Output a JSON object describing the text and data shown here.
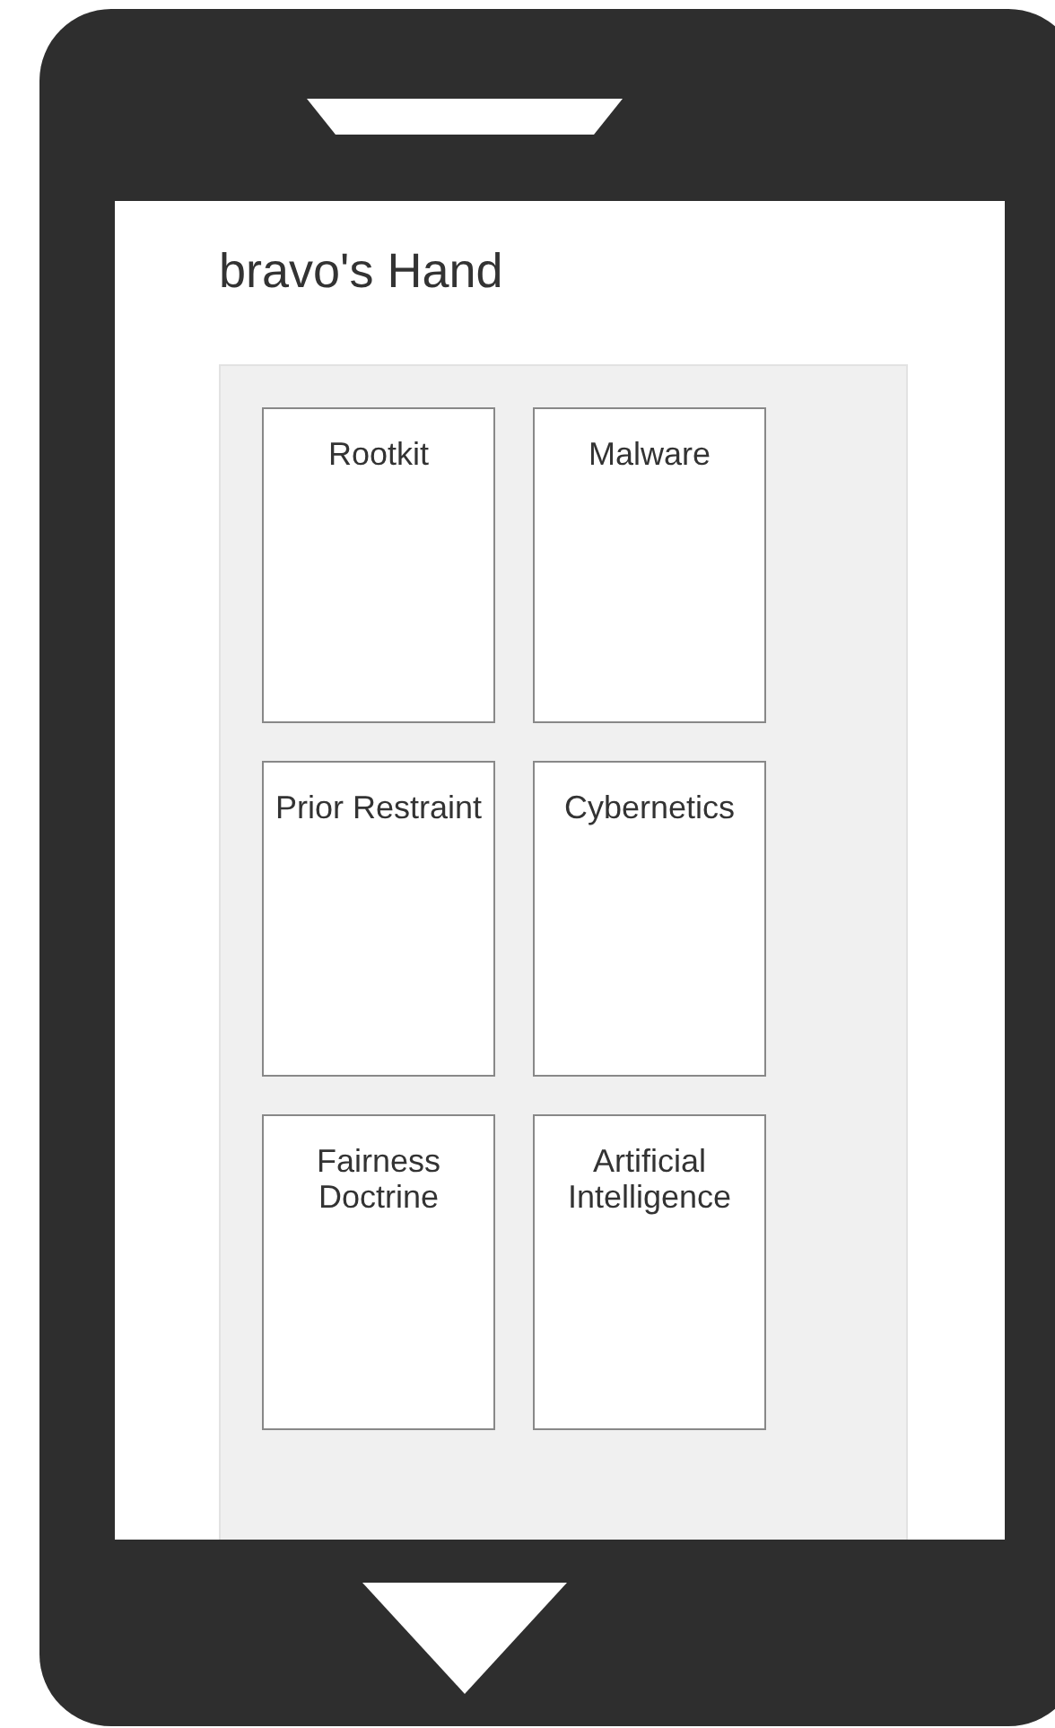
{
  "screen": {
    "title": "bravo's Hand"
  },
  "cards": [
    {
      "label": "Rootkit"
    },
    {
      "label": "Malware"
    },
    {
      "label": "Prior Restraint"
    },
    {
      "label": "Cybernetics"
    },
    {
      "label": "Fairness Doctrine"
    },
    {
      "label": "Artificial Intelligence"
    }
  ]
}
